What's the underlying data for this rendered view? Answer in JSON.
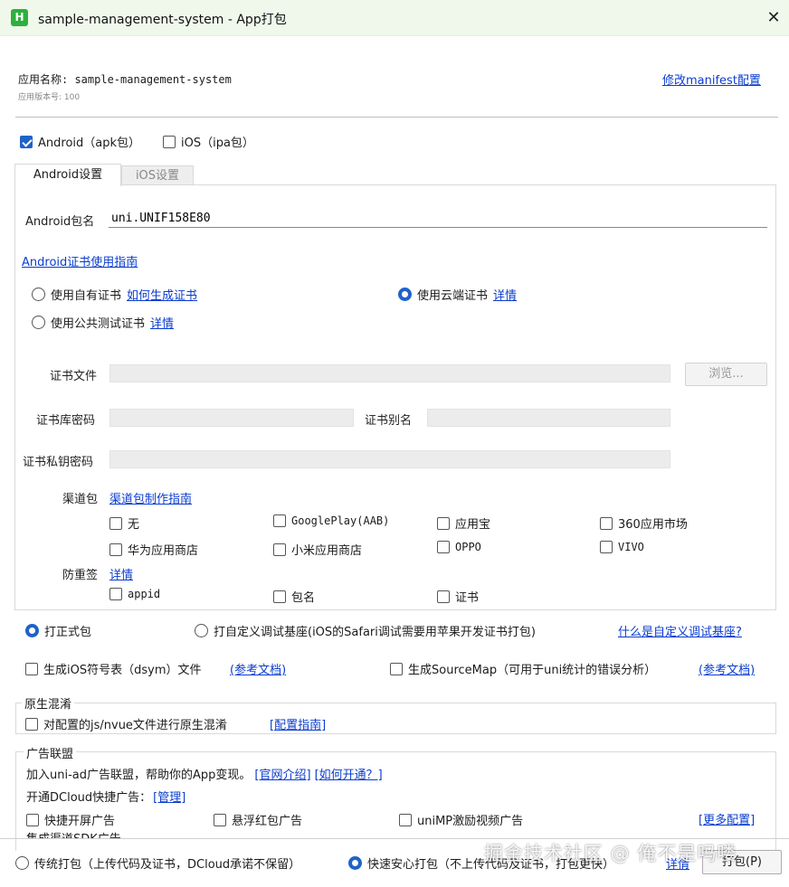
{
  "window": {
    "title": "sample-management-system - App打包",
    "close_symbol": "✕"
  },
  "header": {
    "app_name_label": "应用名称: sample-management-system",
    "version_label": "应用版本号: 100",
    "manifest_link": "修改manifest配置"
  },
  "platforms": {
    "android": {
      "label": "Android（apk包）",
      "checked": true
    },
    "ios": {
      "label": "iOS（ipa包）",
      "checked": false
    }
  },
  "tabs": [
    {
      "label": "Android设置",
      "active": true
    },
    {
      "label": "iOS设置",
      "active": false
    }
  ],
  "android": {
    "package_label": "Android包名",
    "package_value": "uni.UNIF158E80",
    "cert_guide_link": "Android证书使用指南",
    "cert_options": {
      "own": {
        "label": "使用自有证书",
        "link": "如何生成证书"
      },
      "cloud": {
        "label": "使用云端证书",
        "link": "详情"
      },
      "public": {
        "label": "使用公共测试证书",
        "link": "详情"
      }
    },
    "cert_file_label": "证书文件",
    "browse_button": "浏览...",
    "keystore_pwd_label": "证书库密码",
    "alias_label": "证书别名",
    "private_pwd_label": "证书私钥密码",
    "channel_label": "渠道包",
    "channel_guide_link": "渠道包制作指南",
    "channels": [
      "无",
      "GooglePlay(AAB)",
      "应用宝",
      "360应用市场",
      "华为应用商店",
      "小米应用商店",
      "OPPO",
      "VIVO"
    ],
    "anti_label": "防重签",
    "anti_link": "详情",
    "anti_options": [
      "appid",
      "包名",
      "证书"
    ]
  },
  "build_mode": {
    "formal": "打正式包",
    "custom": "打自定义调试基座(iOS的Safari调试需要用苹果开发证书打包)",
    "custom_link": "什么是自定义调试基座?"
  },
  "symbols": {
    "dsym": "生成iOS符号表（dsym）文件",
    "dsym_link": "(参考文档)",
    "sourcemap": "生成SourceMap（可用于uni统计的错误分析）",
    "sourcemap_link": "(参考文档)"
  },
  "obfuscation": {
    "group_title": "原生混淆",
    "checkbox_label": "对配置的js/nvue文件进行原生混淆",
    "link": "[配置指南]"
  },
  "ads": {
    "group_title": "广告联盟",
    "intro": "加入uni-ad广告联盟，帮助你的App变现。",
    "intro_link1": "[官网介绍]",
    "intro_link2": "[如何开通？]",
    "dcloud_label": "开通DCloud快捷广告：",
    "dcloud_link": "[管理]",
    "options": [
      "快捷开屏广告",
      "悬浮红包广告",
      "uniMP激励视频广告"
    ],
    "more_link": "[更多配置]",
    "cut_text": "集成渠道SDK广告"
  },
  "bottom": {
    "traditional": "传统打包（上传代码及证书，DCloud承诺不保留）",
    "fast": "快速安心打包（不上传代码及证书，打包更快）",
    "detail_link": "详情",
    "build_button": "打包(P)"
  },
  "watermark": "掘金技术社区 @ 俺不是吗喽",
  "colors": {
    "accent": "#1f63c8",
    "link": "#0a3ccf",
    "titlebar": "#f0f8ec"
  }
}
